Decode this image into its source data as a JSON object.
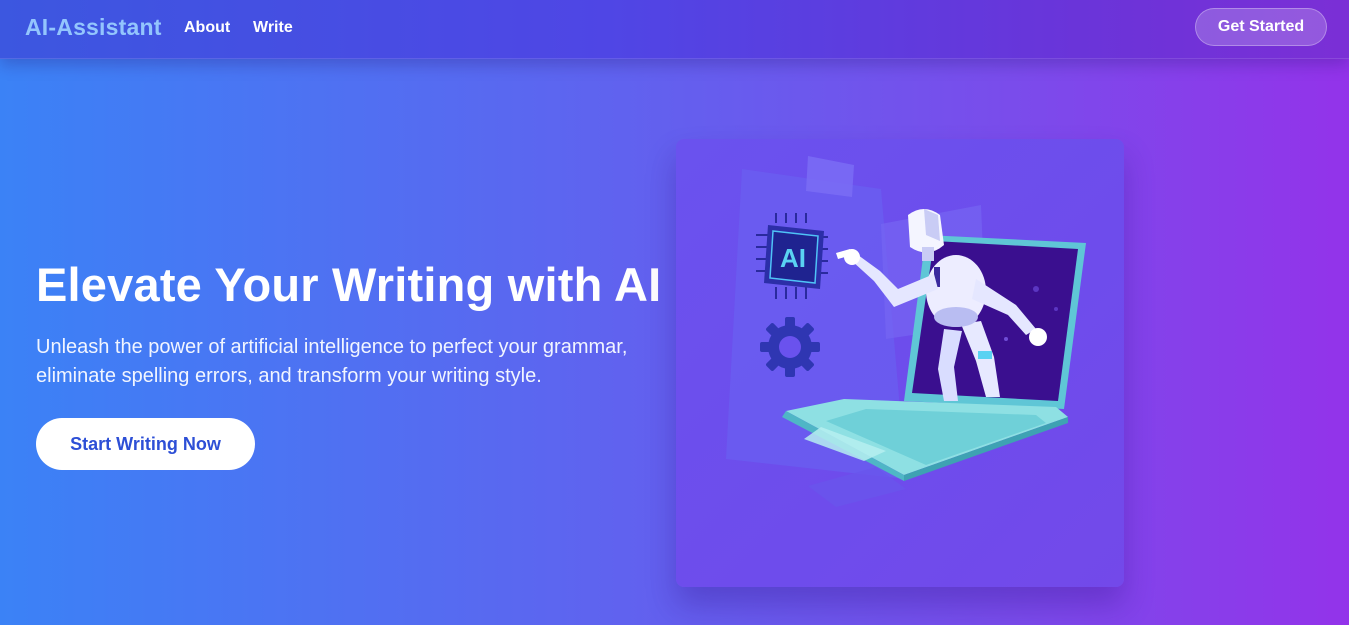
{
  "nav": {
    "brand": "AI-Assistant",
    "links": [
      "About",
      "Write"
    ],
    "cta_label": "Get Started"
  },
  "hero": {
    "title": "Elevate Your Writing with AI",
    "subtitle": "Unleash the power of artificial intelligence to perfect your grammar, eliminate spelling errors, and transform your writing style.",
    "button_label": "Start Writing Now"
  },
  "illustration": {
    "chip_label": "AI"
  },
  "colors": {
    "brand": "#93c5fd",
    "gradient_start": "#3b82f6",
    "gradient_end": "#9333ea",
    "cta_text": "#2d4fd6"
  }
}
